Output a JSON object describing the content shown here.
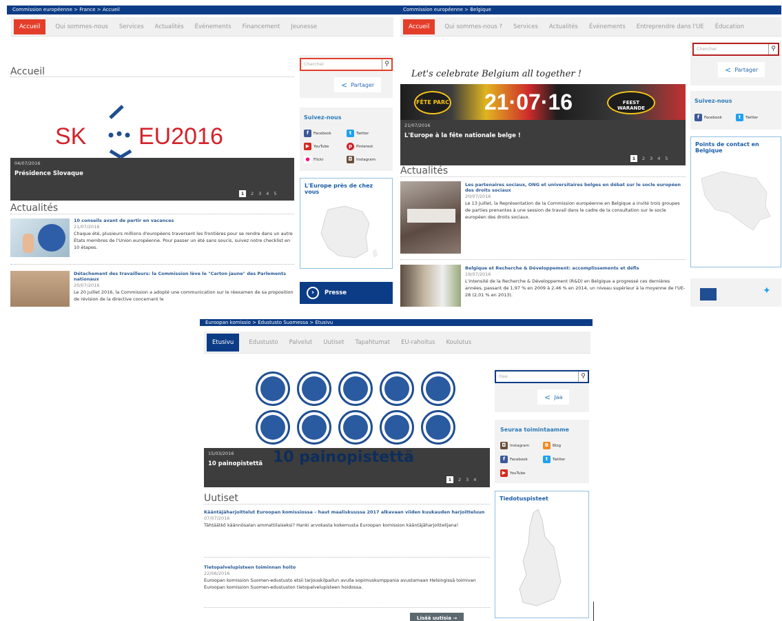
{
  "france": {
    "breadcrumb": "Commission européenne > France > Accueil",
    "nav": [
      "Accueil",
      "Qui sommes-nous",
      "Services",
      "Actualités",
      "Événements",
      "Financement",
      "Jeunesse"
    ],
    "heading": "Accueil",
    "slide_logo_left": "SK",
    "slide_logo_right": "EU2016",
    "slide_date": "04/07/2016",
    "slide_title": "Présidence Slovaque",
    "pager": [
      "1",
      "2",
      "3",
      "4",
      "5"
    ],
    "news_heading": "Actualités",
    "news": [
      {
        "title": "10 conseils avant de partir en vacances",
        "date": "21/07/2016",
        "text": "Chaque été, plusieurs millions d'européens traversent les frontières pour se rendre dans un autre États membres de l'Union européenne. Pour passer un été sans soucis, suivez notre checklist en 10 étapes."
      },
      {
        "title": "Détachement des travailleurs: la Commission lève le \"Carton jaune\" des Parlements nationaux",
        "date": "20/07/2016",
        "text": "Le 20 juillet 2016, la Commission a adopté une communication sur le réexamen de sa proposition de révision de la directive concernant le"
      }
    ],
    "search_placeholder": "Chercher",
    "share": "Partager",
    "follow_title": "Suivez-nous",
    "social": [
      "Facebook",
      "Twitter",
      "YouTube",
      "Pinterest",
      "Flickr",
      "Instagram"
    ],
    "map_title": "L'Europe près de chez vous",
    "press": "Presse"
  },
  "belgium": {
    "breadcrumb": "Commission européenne > Belgique",
    "nav": [
      "Accueil",
      "Qui sommes-nous ?",
      "Services",
      "Actualités",
      "Événements",
      "Entreprendre dans l'UE",
      "Éducation"
    ],
    "banner_script": "Let's celebrate Belgium all together !",
    "banner_left": "FÊTE PARC",
    "banner_date": "21·07·16",
    "banner_right": "FEEST WARANDE",
    "slide_date": "21/07/2016",
    "slide_title": "L'Europe à la fête nationale belge !",
    "pager": [
      "1",
      "2",
      "3",
      "4",
      "5"
    ],
    "news_heading": "Actualités",
    "news": [
      {
        "title": "Les partenaires sociaux, ONG et universitaires belges en débat sur le socle européen des droits sociaux",
        "date": "20/07/2016",
        "text": "Le 13 Juillet, la Représentation de la Commission européenne en Belgique a invité trois groupes de parties prenantes à une session de travail dans le cadre de la consultation sur le socle européen des droits sociaux."
      },
      {
        "title": "Belgique et Recherche & Développement: accomplissements et défis",
        "date": "19/07/2016",
        "text": "L'intensité de la Recherche & Développement (R&D) en Belgique a progressé ces dernières années, passant de 1,97 % en 2009 à 2,46 % en 2014, un niveau supérieur à la moyenne de l'UE-28 (2,01 % en 2013)."
      }
    ],
    "search_placeholder": "Chercher",
    "share": "Partager",
    "follow_title": "Suivez-nous",
    "social": [
      "Facebook",
      "Twitter"
    ],
    "map_title": "Points de contact en Belgique"
  },
  "finland": {
    "breadcrumb": "Euroopan komissio > Edustusto Suomessa > Etusivu",
    "nav": [
      "Etusivu",
      "Edustusto",
      "Palvelut",
      "Uutiset",
      "Tapahtumat",
      "EU-rahoitus",
      "Koulutus"
    ],
    "slide_date": "15/03/2016",
    "slide_title": "10 painopistettä",
    "slide_big": "10 painopistettä",
    "pager": [
      "1",
      "2",
      "3",
      "4"
    ],
    "news_heading": "Uutiset",
    "news": [
      {
        "title": "Kääntäjäharjoittelut Euroopan komissiossa – haut maaliskuussa 2017 alkavaan viiden kuukauden harjoitteluun",
        "date": "07/07/2016",
        "text": "Tähtäätkö käännösalan ammattilaiseksi? Hanki arvokasta kokemusta Euroopan komission kääntäjäharjoittelijana!"
      },
      {
        "title": "Tietopalvelupisteen toiminnan hoito",
        "date": "22/06/2016",
        "text": "Euroopan komission Suomen-edustusto etsii tarjouskilpailun avulla sopimuskumppania avustamaan Helsingissä toimivan Euroopan komission Suomen-edustuston tietopalvelupisteen hoidossa."
      }
    ],
    "search_placeholder": "Hae",
    "share": "Jaa",
    "follow_title": "Seuraa toimintaamme",
    "social": [
      "Instagram",
      "Blog",
      "Facebook",
      "Twitter",
      "YouTube"
    ],
    "map_title": "Tiedotuspisteet",
    "more": "Lisää uutisia →"
  },
  "colors": {
    "eu_blue": "#0d3c86",
    "accent_red": "#e43e2b",
    "link_blue": "#2b5a96"
  }
}
